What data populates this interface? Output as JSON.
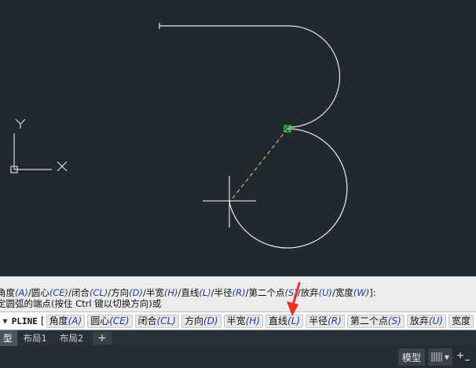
{
  "canvas": {
    "background": "#212830",
    "ucs": {
      "y_label": "Y",
      "x_label": "X"
    }
  },
  "history": {
    "line1_parts": [
      {
        "t": "角度",
        "k": "(A)"
      },
      {
        "t": "/圆心",
        "k": "(CE)"
      },
      {
        "t": "/闭合",
        "k": "(CL)"
      },
      {
        "t": "/方向",
        "k": "(D)"
      },
      {
        "t": "/半宽",
        "k": "(H)"
      },
      {
        "t": "/直线",
        "k": "(L)"
      },
      {
        "t": "/半径",
        "k": "(R)"
      },
      {
        "t": "/第二个点",
        "k": "(S)"
      },
      {
        "t": "/放弃",
        "k": "(U)"
      },
      {
        "t": "/宽度",
        "k": "(W)"
      },
      {
        "t": "]:",
        "k": ""
      }
    ],
    "line2": "定圆弧的端点(按住 Ctrl 键以切换方向)或"
  },
  "command": {
    "prompt": "PLINE",
    "bracket": "[",
    "options": [
      {
        "label": "角度",
        "key": "(A)"
      },
      {
        "label": "圆心",
        "key": "(CE)"
      },
      {
        "label": "闭合",
        "key": "(CL)"
      },
      {
        "label": "方向",
        "key": "(D)"
      },
      {
        "label": "半宽",
        "key": "(H)"
      },
      {
        "label": "直线",
        "key": "(L)"
      },
      {
        "label": "半径",
        "key": "(R)"
      },
      {
        "label": "第二个点",
        "key": "(S)"
      },
      {
        "label": "放弃",
        "key": "(U)"
      },
      {
        "label": "宽度",
        "key": ""
      }
    ]
  },
  "tabs": [
    {
      "label": "型",
      "active": true
    },
    {
      "label": "布局1",
      "active": false
    },
    {
      "label": "布局2",
      "active": false
    },
    {
      "label": "+",
      "active": false
    }
  ],
  "status": {
    "model_label": "模型",
    "grid_icon": "grid-icon",
    "snap_icon": "snap-icon"
  },
  "annotation_color": "#e8302a"
}
